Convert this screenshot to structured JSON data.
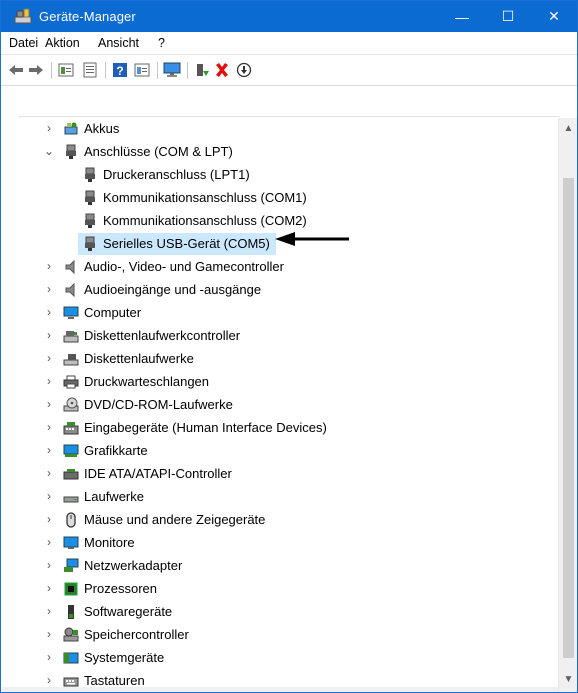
{
  "window": {
    "title": "Geräte-Manager",
    "buttons": {
      "minimize": "—",
      "maximize": "☐",
      "close": "✕"
    }
  },
  "menu": [
    "Datei",
    "Aktion",
    "Ansicht",
    "?"
  ],
  "toolbar_icons": [
    "back-arrow-icon",
    "forward-arrow-icon",
    "properties-icon",
    "view-icon",
    "help-icon",
    "driver-icon",
    "monitor-scan-icon",
    "enable-device-icon",
    "uninstall-x-icon",
    "update-driver-icon"
  ],
  "tree": [
    {
      "label": "Akkus",
      "expanded": false,
      "indent": 0,
      "icon": "battery-icon"
    },
    {
      "label": "Anschlüsse (COM & LPT)",
      "expanded": true,
      "indent": 0,
      "icon": "port-icon"
    },
    {
      "label": "Druckeranschluss (LPT1)",
      "indent": 1,
      "icon": "port-icon"
    },
    {
      "label": "Kommunikationsanschluss (COM1)",
      "indent": 1,
      "icon": "port-icon"
    },
    {
      "label": "Kommunikationsanschluss (COM2)",
      "indent": 1,
      "icon": "port-icon"
    },
    {
      "label": "Serielles USB-Gerät (COM5)",
      "indent": 1,
      "icon": "port-icon",
      "selected": true
    },
    {
      "label": "Audio-, Video- und Gamecontroller",
      "expanded": false,
      "indent": 0,
      "icon": "speaker-icon"
    },
    {
      "label": "Audioeingänge und -ausgänge",
      "expanded": false,
      "indent": 0,
      "icon": "speaker-icon"
    },
    {
      "label": "Computer",
      "expanded": false,
      "indent": 0,
      "icon": "computer-icon"
    },
    {
      "label": "Diskettenlaufwerkcontroller",
      "expanded": false,
      "indent": 0,
      "icon": "floppy-controller-icon"
    },
    {
      "label": "Diskettenlaufwerke",
      "expanded": false,
      "indent": 0,
      "icon": "floppy-drive-icon"
    },
    {
      "label": "Druckwarteschlangen",
      "expanded": false,
      "indent": 0,
      "icon": "printer-icon"
    },
    {
      "label": "DVD/CD-ROM-Laufwerke",
      "expanded": false,
      "indent": 0,
      "icon": "dvd-drive-icon"
    },
    {
      "label": "Eingabegeräte (Human Interface Devices)",
      "expanded": false,
      "indent": 0,
      "icon": "hid-icon"
    },
    {
      "label": "Grafikkarte",
      "expanded": false,
      "indent": 0,
      "icon": "display-adapter-icon"
    },
    {
      "label": "IDE ATA/ATAPI-Controller",
      "expanded": false,
      "indent": 0,
      "icon": "ide-controller-icon"
    },
    {
      "label": "Laufwerke",
      "expanded": false,
      "indent": 0,
      "icon": "disk-drive-icon"
    },
    {
      "label": "Mäuse und andere Zeigegeräte",
      "expanded": false,
      "indent": 0,
      "icon": "mouse-icon"
    },
    {
      "label": "Monitore",
      "expanded": false,
      "indent": 0,
      "icon": "monitor-icon"
    },
    {
      "label": "Netzwerkadapter",
      "expanded": false,
      "indent": 0,
      "icon": "network-adapter-icon"
    },
    {
      "label": "Prozessoren",
      "expanded": false,
      "indent": 0,
      "icon": "processor-icon"
    },
    {
      "label": "Softwaregeräte",
      "expanded": false,
      "indent": 0,
      "icon": "software-device-icon"
    },
    {
      "label": "Speichercontroller",
      "expanded": false,
      "indent": 0,
      "icon": "storage-controller-icon"
    },
    {
      "label": "Systemgeräte",
      "expanded": false,
      "indent": 0,
      "icon": "system-device-icon"
    },
    {
      "label": "Tastaturen",
      "expanded": false,
      "indent": 0,
      "icon": "keyboard-icon"
    }
  ],
  "colors": {
    "titlebar": "#0b6bd0",
    "selection": "#cce8ff",
    "accent": "#1c6fd6"
  }
}
